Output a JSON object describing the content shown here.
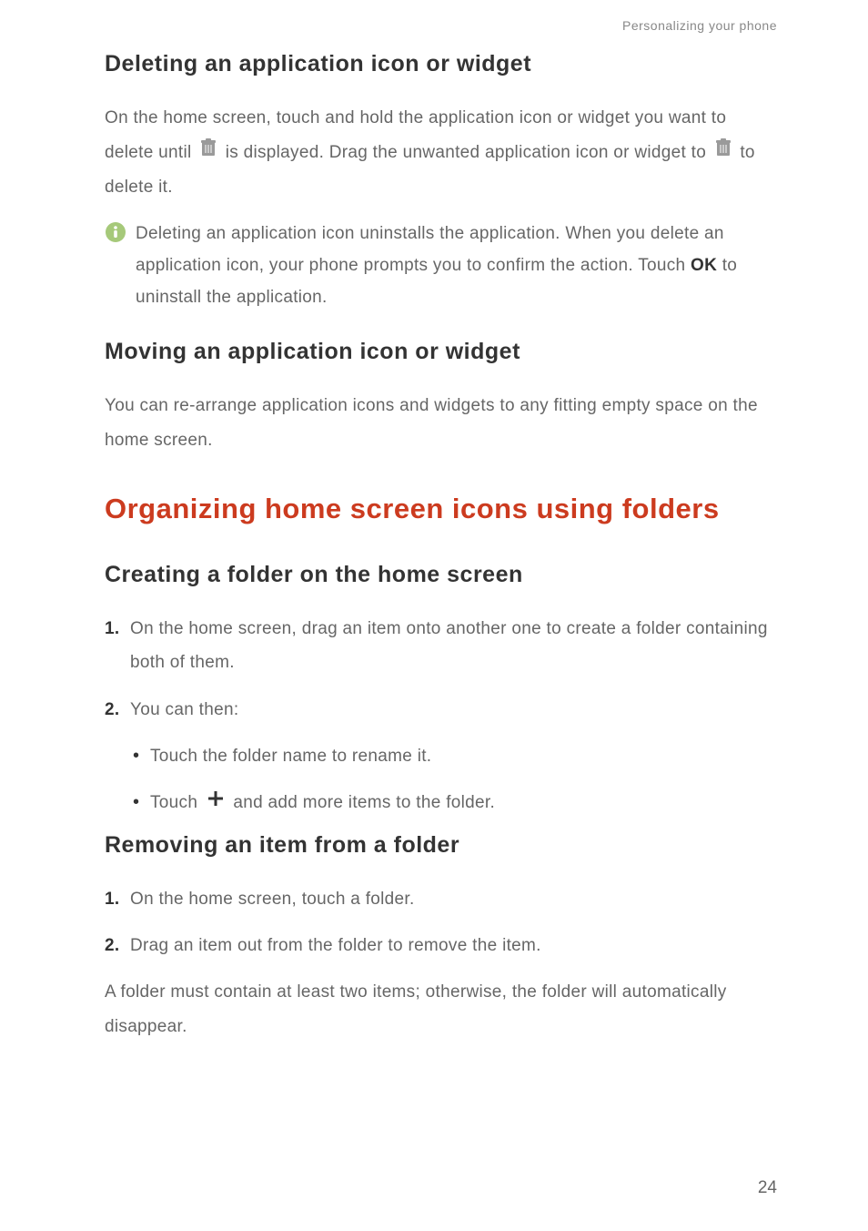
{
  "header": "Personalizing your phone",
  "section1": {
    "title": "Deleting an application icon or widget",
    "p1a": "On the home screen, touch and hold the application icon or widget you want to delete until ",
    "p1b": " is displayed. Drag the unwanted application icon or widget to ",
    "p1c": " to delete it."
  },
  "info": {
    "text1": "Deleting an application icon uninstalls the application. When you delete an application icon, your phone prompts you to confirm the action. Touch ",
    "ok": "OK",
    "text2": " to uninstall the application."
  },
  "section2": {
    "title": "Moving an application icon or widget",
    "text": "You can re-arrange application icons and widgets to any fitting empty space on the home screen."
  },
  "mainHeading": "Organizing home screen icons using folders",
  "section3": {
    "title": "Creating a folder on the home screen",
    "step1": "On the home screen, drag an item onto another one to create a folder containing both of them.",
    "step2": "You can then:",
    "bullet1": "Touch the folder name to rename it.",
    "bullet2a": "Touch ",
    "bullet2b": " and add more items to the folder."
  },
  "section4": {
    "title": "Removing an item from a folder",
    "step1": "On the home screen, touch a folder.",
    "step2": "Drag an item out from the folder to remove the item.",
    "note": "A folder must contain at least two items; otherwise, the folder will automatically disappear."
  },
  "pageNumber": "24",
  "nums": {
    "n1": "1.",
    "n2": "2."
  }
}
